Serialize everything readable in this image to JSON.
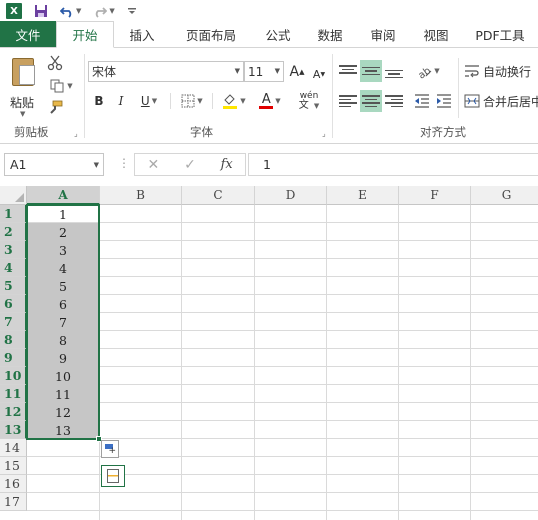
{
  "quick_access": {
    "app_icon": "X",
    "icons": [
      "save-icon",
      "undo-icon",
      "redo-icon",
      "customize-icon"
    ]
  },
  "tabs": [
    {
      "label": "文件"
    },
    {
      "label": "开始"
    },
    {
      "label": "插入"
    },
    {
      "label": "页面布局"
    },
    {
      "label": "公式"
    },
    {
      "label": "数据"
    },
    {
      "label": "审阅"
    },
    {
      "label": "视图"
    },
    {
      "label": "PDF工具"
    }
  ],
  "ribbon": {
    "clipboard": {
      "paste_label": "粘贴",
      "group_label": "剪贴板"
    },
    "font": {
      "font_name": "宋体",
      "font_size": "11",
      "grow_label": "A",
      "shrink_label": "A",
      "bold": "B",
      "italic": "I",
      "underline": "U",
      "font_color_letter": "A",
      "phonetic": "wén",
      "group_label": "字体"
    },
    "alignment": {
      "wrap_text": "自动换行",
      "merge_center": "合并后居中",
      "group_label": "对齐方式"
    }
  },
  "formula_bar": {
    "name_box": "A1",
    "fx": "fx",
    "value": "1"
  },
  "sheet": {
    "columns": [
      "A",
      "B",
      "C",
      "D",
      "E",
      "F",
      "G"
    ],
    "rows": [
      "1",
      "2",
      "3",
      "4",
      "5",
      "6",
      "7",
      "8",
      "9",
      "10",
      "11",
      "12",
      "13",
      "14",
      "15",
      "16",
      "17"
    ],
    "col_a_values": [
      "1",
      "2",
      "3",
      "4",
      "5",
      "6",
      "7",
      "8",
      "9",
      "10",
      "11",
      "12",
      "13"
    ]
  },
  "colors": {
    "accent": "#217346",
    "selection_fill": "#c6c6c6"
  }
}
